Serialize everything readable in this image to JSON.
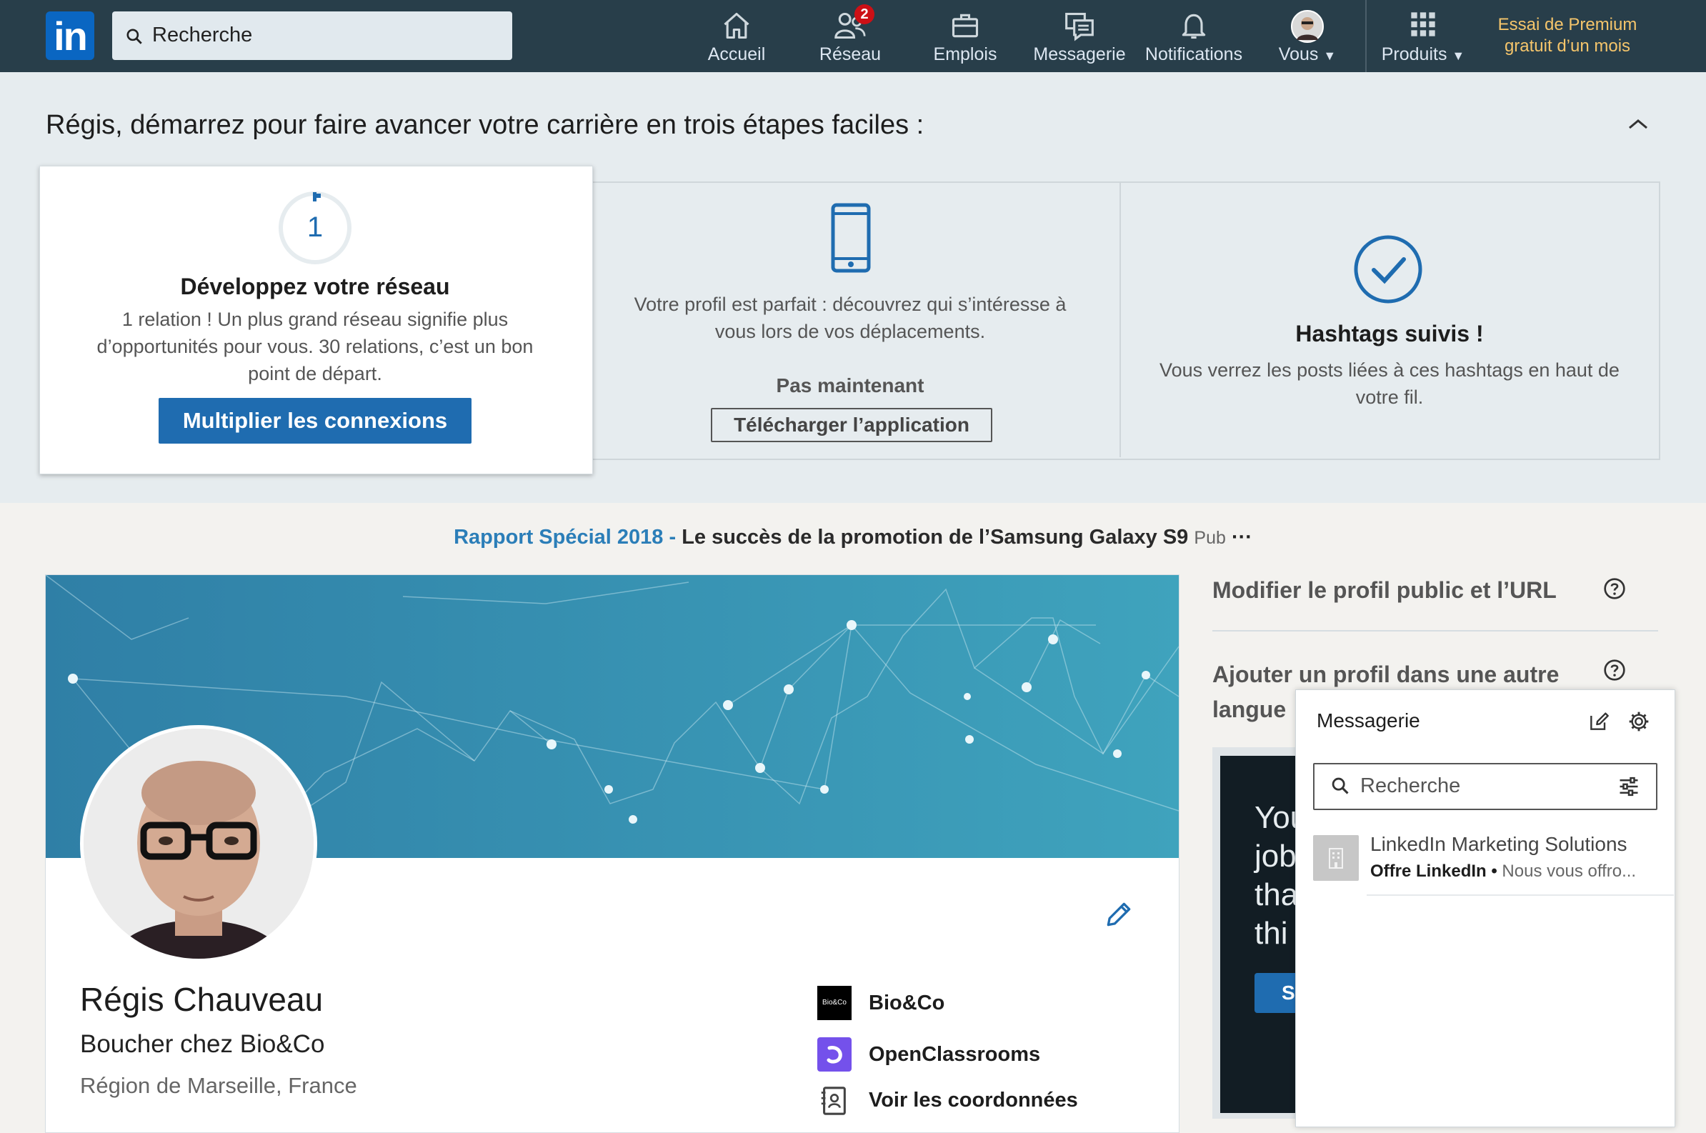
{
  "nav": {
    "logo": "in",
    "search_placeholder": "Recherche",
    "items": [
      {
        "label": "Accueil",
        "icon": "home-icon"
      },
      {
        "label": "Réseau",
        "icon": "network-icon",
        "badge": "2"
      },
      {
        "label": "Emplois",
        "icon": "jobs-icon"
      },
      {
        "label": "Messagerie",
        "icon": "messaging-icon"
      },
      {
        "label": "Notifications",
        "icon": "bell-icon"
      },
      {
        "label": "Vous",
        "icon": "avatar"
      },
      {
        "label": "Produits",
        "icon": "grid-icon"
      }
    ],
    "premium": "Essai de Premium gratuit d’un mois"
  },
  "onboarding": {
    "title": "Régis, démarrez pour faire avancer votre carrière en trois étapes faciles :",
    "card1": {
      "step": "1",
      "title": "Développez votre réseau",
      "text": "1 relation ! Un plus grand réseau signifie plus d’opportunités pour vous. 30 relations, c’est un bon point de départ.",
      "button": "Multiplier les connexions"
    },
    "card2": {
      "text": "Votre profil est parfait : découvrez qui s’intéresse à vous lors de vos déplacements.",
      "secondary": "Pas maintenant",
      "button": "Télécharger l’application"
    },
    "card3": {
      "title": "Hashtags suivis !",
      "text": "Vous verrez les posts liées à ces hashtags en haut de votre fil."
    }
  },
  "ad": {
    "highlight": "Rapport Spécial 2018 -",
    "text": "Le succès de la promotion de l’Samsung Galaxy S9",
    "pub": "Pub",
    "more": "···"
  },
  "profile": {
    "name": "Régis Chauveau",
    "headline": "Boucher chez Bio&Co",
    "location": "Région de Marseille, France",
    "company": "Bio&Co",
    "company_logo_text": "Bio&Co",
    "school": "OpenClassrooms",
    "contact": "Voir les coordonnées"
  },
  "right": {
    "edit_public": "Modifier le profil public et l’URL",
    "add_language": "Ajouter un profil dans une autre langue",
    "ad_text": [
      "You",
      "job",
      "tha",
      "thi"
    ],
    "ad_button": "S"
  },
  "messaging": {
    "title": "Messagerie",
    "search_placeholder": "Recherche",
    "conversation": {
      "name": "LinkedIn Marketing Solutions",
      "sender": "Offre LinkedIn •",
      "preview": "Nous vous offro..."
    }
  }
}
